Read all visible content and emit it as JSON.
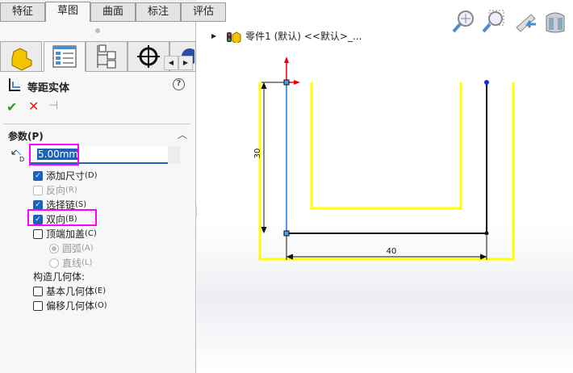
{
  "tabs": [
    {
      "label": "特征"
    },
    {
      "label": "草图"
    },
    {
      "label": "曲面"
    },
    {
      "label": "标注"
    },
    {
      "label": "评估"
    }
  ],
  "property_manager": {
    "title": "等距实体",
    "help": "?",
    "section": "参数(P)",
    "offset_value": "5.00mm",
    "options": [
      {
        "label": "添加尺寸",
        "key": "(D)",
        "checked": true
      },
      {
        "label": "反向",
        "key": "(R)",
        "checked": false,
        "disabled": true
      },
      {
        "label": "选择链",
        "key": "(S)",
        "checked": true
      },
      {
        "label": "双向",
        "key": "(B)",
        "checked": true
      },
      {
        "label": "顶端加盖",
        "key": "(C)",
        "checked": false
      }
    ],
    "cap_options": [
      {
        "label": "圆弧",
        "key": "(A)",
        "selected": true
      },
      {
        "label": "直线",
        "key": "(L)",
        "selected": false
      }
    ],
    "construction_label": "构造几何体:",
    "construction_options": [
      {
        "label": "基本几何体",
        "key": "(E)",
        "checked": false
      },
      {
        "label": "偏移几何体",
        "key": "(O)",
        "checked": false
      }
    ]
  },
  "viewport": {
    "tree_item": "零件1 (默认) <<默认>_...",
    "dim_vertical": "30",
    "dim_horizontal": "40"
  },
  "colors": {
    "offset": "#ffff00",
    "selected": "#4a9ee8",
    "highlight": "#ff00ff",
    "accent": "#1b63b8"
  }
}
